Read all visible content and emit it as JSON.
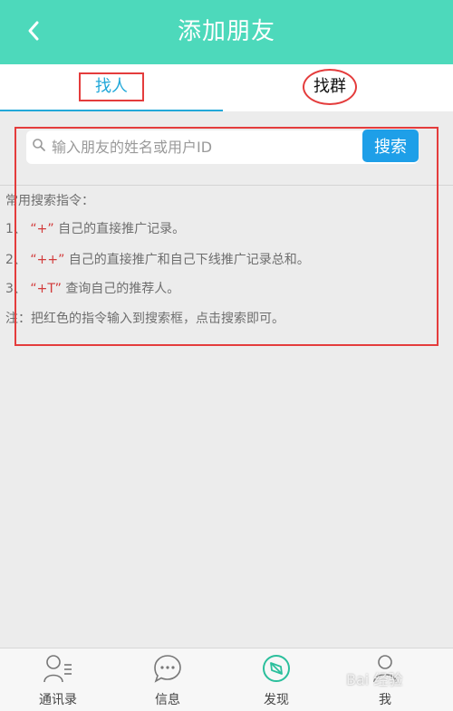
{
  "header": {
    "title": "添加朋友"
  },
  "tabs": [
    {
      "label": "找人",
      "active": true
    },
    {
      "label": "找群",
      "active": false
    }
  ],
  "search": {
    "placeholder": "输入朋友的姓名或用户ID",
    "button_label": "搜索"
  },
  "guide": {
    "heading": "常用搜索指令：",
    "lines": [
      {
        "num": "1、",
        "cmd": "“+”",
        "desc": "自己的直接推广记录。"
      },
      {
        "num": "2、",
        "cmd": "“++”",
        "desc": "自己的直接推广和自己下线推广记录总和。"
      },
      {
        "num": "3、",
        "cmd": "“+T”",
        "desc": "查询自己的推荐人。"
      }
    ],
    "note": "注：把红色的指令输入到搜索框，点击搜索即可。"
  },
  "bottom_nav": [
    {
      "label": "通讯录",
      "icon": "contacts-icon"
    },
    {
      "label": "信息",
      "icon": "message-icon"
    },
    {
      "label": "发现",
      "icon": "compass-icon"
    },
    {
      "label": "我",
      "icon": "profile-icon"
    }
  ],
  "watermark": "Bai 经验",
  "colors": {
    "header": "#4dd9bb",
    "accent": "#22a8d9",
    "search_button": "#1e9fe8",
    "annotation_red": "#e43c3c",
    "command_red": "#d23a3a"
  }
}
